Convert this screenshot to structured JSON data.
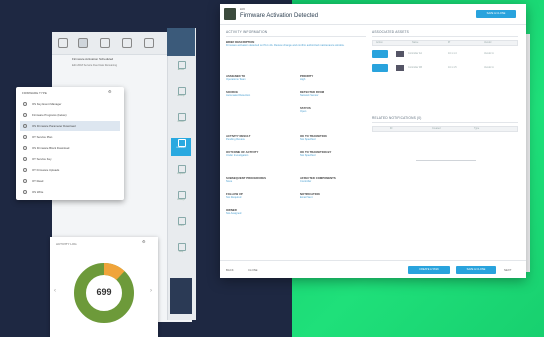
{
  "colors": {
    "accent": "#29a3dd",
    "navy": "#1e2842",
    "green": "#1fe07a",
    "donut_green": "#6d9a3a",
    "donut_orange": "#f0a43a"
  },
  "back_app": {
    "list_header": "Firmware Activation Scheduled",
    "list_sub": "Edit 2018 Service Due Date Remaining"
  },
  "popup": {
    "title": "FIRMWARE TYPE",
    "items": [
      {
        "label": "OS Key Event Manager",
        "selected": false
      },
      {
        "label": "Firmware Programs (below)",
        "selected": false
      },
      {
        "label": "OS Firmware Parameter Download",
        "selected": true
      },
      {
        "label": "OT Service Plan",
        "selected": false
      },
      {
        "label": "OS Firmware Block Download",
        "selected": false
      },
      {
        "label": "OT Service Key",
        "selected": false
      },
      {
        "label": "OT Firmware Uploads",
        "selected": false
      },
      {
        "label": "OT Read",
        "selected": false
      },
      {
        "label": "OS Write",
        "selected": false
      }
    ]
  },
  "nav": {
    "items": [
      {
        "label": "Assets",
        "icon": "box-icon"
      },
      {
        "label": "Activity",
        "icon": "list-icon"
      },
      {
        "label": "Events",
        "icon": "bell-icon"
      },
      {
        "label": "Firmware",
        "icon": "chip-icon",
        "active": true
      },
      {
        "label": "Reports",
        "icon": "chart-icon"
      },
      {
        "label": "Settings",
        "icon": "gear-icon"
      },
      {
        "label": "Users",
        "icon": "user-icon"
      },
      {
        "label": "Help",
        "icon": "help-icon"
      }
    ]
  },
  "widget": {
    "title": "ACTIVITY LOG",
    "value": "699",
    "fraction_orange": 0.12
  },
  "dialog": {
    "sub": "ERR",
    "title": "Firmware Activation Detected",
    "header_button": "SAVE & CLOSE",
    "left_section": "ACTIVITY INFORMATION",
    "fields": [
      {
        "label": "BRIEF DESCRIPTION",
        "value": "Firmware activation detected on PLC-4A. Review change and confirm authorized maintenance window."
      },
      {
        "label": "ASSIGNED TO",
        "value": "Operations Team"
      },
      {
        "label": "PRIORITY",
        "value": "High"
      },
      {
        "label": "SOURCE",
        "value": "Automated Detection"
      },
      {
        "label": "DETECTED FROM",
        "value": "Network Sensor"
      },
      {
        "label": "STATUS",
        "value": "Open"
      },
      {
        "label": "ACTIVITY RESULT",
        "value": "Pending Review"
      },
      {
        "label": "OK TO TRANSITION",
        "value": "Not Specified"
      },
      {
        "label": "OUTCOME OF ACTIVITY",
        "value": "Under Investigation"
      },
      {
        "label": "OK TO TRANSITION BY",
        "value": "Not Specified"
      },
      {
        "label": "SUBSEQUENT PROCEDURES",
        "value": "None"
      },
      {
        "label": "AFFECTED COMPONENTS",
        "value": "Controller"
      },
      {
        "label": "FOLLOW UP",
        "value": "Not Required"
      },
      {
        "label": "NOTIFICATION",
        "value": "Email Sent"
      },
      {
        "label": "OWNER",
        "value": "Not Assigned"
      }
    ],
    "right_section": "ASSOCIATED ASSETS",
    "assets_headers": [
      "Action",
      "Name",
      "IP",
      "Vendor"
    ],
    "assets": [
      {
        "name": "Controller 4A",
        "ip": "10.1.1.4",
        "vendor": "Vendor A"
      },
      {
        "name": "Controller 4B",
        "ip": "10.1.1.5",
        "vendor": "Vendor A"
      }
    ],
    "related_section": "RELATED NOTIFICATIONS (0)",
    "related_headers": [
      "ID",
      "Created",
      "Type"
    ],
    "footer_left": "BACK",
    "footer_left2": "CLOSE",
    "footer_btn1": "CREATE A TASK",
    "footer_btn2": "SAVE & CLOSE",
    "footer_right": "NEXT"
  }
}
